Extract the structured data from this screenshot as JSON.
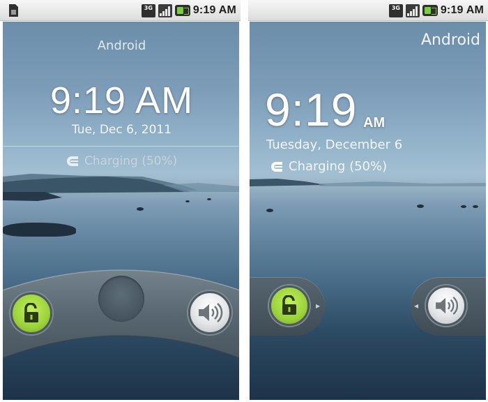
{
  "status_bar": {
    "network": "3G",
    "time": "9:19 AM",
    "icons": [
      "sim-card-icon",
      "3g-icon",
      "signal-strength-icon",
      "battery-charging-icon"
    ]
  },
  "lock_screens": [
    {
      "carrier": "Android",
      "time": "9:19 AM",
      "date": "Tue, Dec 6, 2011",
      "charging_text": "Charging (50%)",
      "controls": [
        "unlock-icon",
        "sound-on-icon"
      ]
    },
    {
      "carrier": "Android",
      "time_main": "9:19",
      "time_ampm": "AM",
      "date": "Tuesday, December 6",
      "charging_text": "Charging (50%)",
      "controls": [
        "unlock-icon",
        "sound-on-icon"
      ]
    }
  ],
  "colors": {
    "unlock_green": "#9bd33a",
    "status_bar_bg": "#e6e6e6",
    "status_text": "#1e1e1e"
  }
}
